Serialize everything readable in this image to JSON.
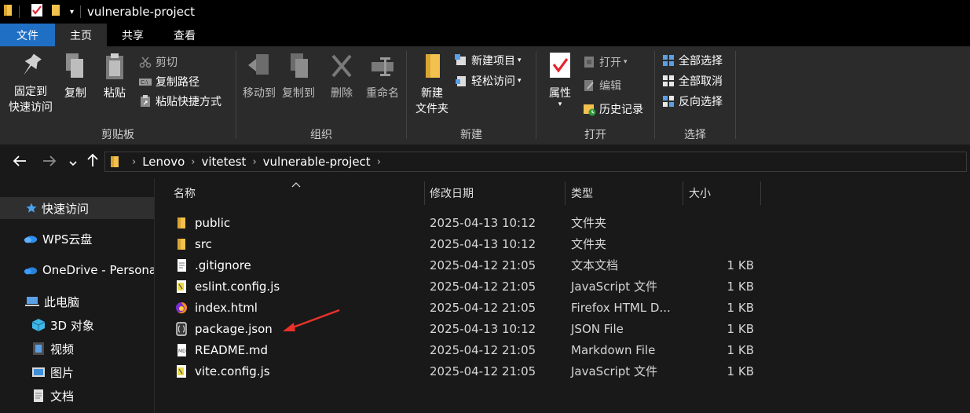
{
  "window": {
    "title": "vulnerable-project"
  },
  "ribbon_tabs": [
    "文件",
    "主页",
    "共享",
    "查看"
  ],
  "ribbon": {
    "clipboard": {
      "label": "剪贴板",
      "pin": "固定到\n快速访问",
      "copy": "复制",
      "paste": "粘贴",
      "cut": "剪切",
      "copy_path": "复制路径",
      "paste_shortcut": "粘贴快捷方式"
    },
    "organize": {
      "label": "组织",
      "move_to": "移动到",
      "copy_to": "复制到",
      "delete": "删除",
      "rename": "重命名"
    },
    "new": {
      "label": "新建",
      "new_folder": "新建\n文件夹",
      "new_item": "新建项目",
      "easy_access": "轻松访问"
    },
    "open": {
      "label": "打开",
      "properties": "属性",
      "open": "打开",
      "edit": "编辑",
      "history": "历史记录"
    },
    "select": {
      "label": "选择",
      "select_all": "全部选择",
      "select_none": "全部取消",
      "invert": "反向选择"
    }
  },
  "breadcrumb": [
    "Lenovo",
    "vitetest",
    "vulnerable-project"
  ],
  "sidebar": [
    {
      "label": "快速访问",
      "icon": "star-icon",
      "selected": true
    },
    {
      "label": "WPS云盘",
      "icon": "cloud-icon"
    },
    {
      "label": "OneDrive - Persona",
      "icon": "onedrive-icon"
    },
    {
      "label": "此电脑",
      "icon": "computer-icon"
    },
    {
      "label": "3D 对象",
      "icon": "cube-icon"
    },
    {
      "label": "视频",
      "icon": "video-icon"
    },
    {
      "label": "图片",
      "icon": "picture-icon"
    },
    {
      "label": "文档",
      "icon": "document-icon"
    }
  ],
  "columns": {
    "name": "名称",
    "date": "修改日期",
    "type": "类型",
    "size": "大小"
  },
  "files": [
    {
      "name": "public",
      "date": "2025-04-13 10:12",
      "type": "文件夹",
      "size": "",
      "icon": "folder-icon"
    },
    {
      "name": "src",
      "date": "2025-04-13 10:12",
      "type": "文件夹",
      "size": "",
      "icon": "folder-icon"
    },
    {
      "name": ".gitignore",
      "date": "2025-04-12 21:05",
      "type": "文本文档",
      "size": "1 KB",
      "icon": "text-file-icon"
    },
    {
      "name": "eslint.config.js",
      "date": "2025-04-12 21:05",
      "type": "JavaScript 文件",
      "size": "1 KB",
      "icon": "js-file-icon"
    },
    {
      "name": "index.html",
      "date": "2025-04-12 21:05",
      "type": "Firefox HTML D...",
      "size": "1 KB",
      "icon": "firefox-html-icon"
    },
    {
      "name": "package.json",
      "date": "2025-04-13 10:12",
      "type": "JSON File",
      "size": "1 KB",
      "icon": "json-file-icon"
    },
    {
      "name": "README.md",
      "date": "2025-04-12 21:05",
      "type": "Markdown File",
      "size": "1 KB",
      "icon": "markdown-file-icon"
    },
    {
      "name": "vite.config.js",
      "date": "2025-04-12 21:05",
      "type": "JavaScript 文件",
      "size": "1 KB",
      "icon": "js-file-icon"
    }
  ],
  "colors": {
    "file_tab": "#1f6fc5",
    "annotation_arrow": "#e8322a",
    "folder": "#f2c14e"
  }
}
